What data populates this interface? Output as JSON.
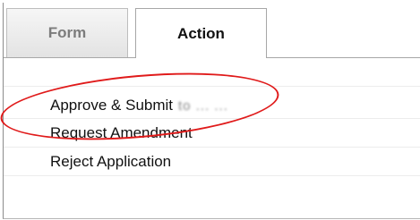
{
  "tabs": [
    {
      "label": "Form",
      "active": false
    },
    {
      "label": "Action",
      "active": true
    }
  ],
  "actions": [
    {
      "label": "Approve & Submit",
      "obscured_suffix": "to ... ..."
    },
    {
      "label": "Request Amendment"
    },
    {
      "label": "Reject Application"
    }
  ],
  "annotation": {
    "shape": "ellipse",
    "color": "#e01a1a",
    "target": "Approve & Submit"
  }
}
